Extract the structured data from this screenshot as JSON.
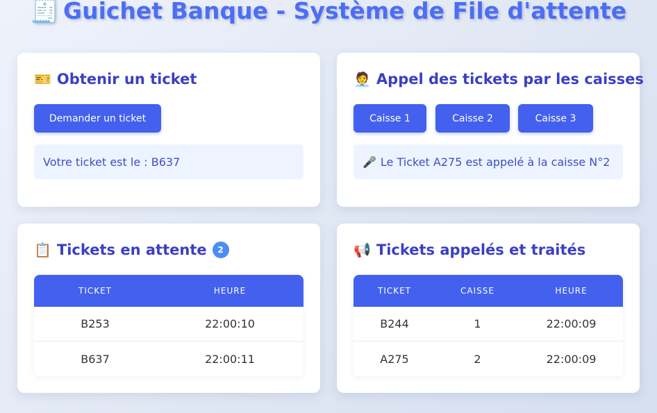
{
  "header": {
    "title_icon": "receipt-icon",
    "title": "Guichet Banque - Système de File d'attente"
  },
  "ticket_panel": {
    "icon": "ticket-icon",
    "title": "Obtenir un ticket",
    "button_label": "Demander un ticket",
    "message": "Votre ticket est le : B637"
  },
  "call_panel": {
    "icon": "clerk-icon",
    "title": "Appel des tickets par les caisses",
    "buttons": [
      "Caisse 1",
      "Caisse 2",
      "Caisse 3"
    ],
    "message_icon": "microphone-icon",
    "message": "Le Ticket A275 est appelé à la caisse N°2"
  },
  "waiting_panel": {
    "icon": "clipboard-icon",
    "title": "Tickets en attente",
    "count": "2",
    "columns": [
      "TICKET",
      "HEURE"
    ],
    "rows": [
      [
        "B253",
        "22:00:10"
      ],
      [
        "B637",
        "22:00:11"
      ]
    ]
  },
  "called_panel": {
    "icon": "megaphone-icon",
    "title": "Tickets appelés et traités",
    "columns": [
      "TICKET",
      "CAISSE",
      "HEURE"
    ],
    "rows": [
      [
        "B244",
        "1",
        "22:00:09"
      ],
      [
        "A275",
        "2",
        "22:00:09"
      ]
    ]
  },
  "colors": {
    "accent": "#4361ee",
    "title": "#4c6ef5",
    "heading": "#3b3fc4",
    "info_bg": "#eef4ff"
  }
}
